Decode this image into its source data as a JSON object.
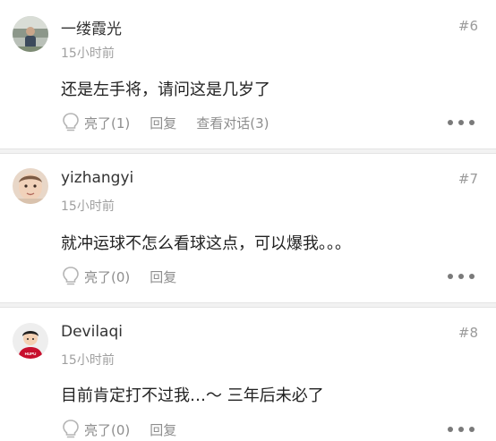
{
  "comments": [
    {
      "username": "一缕霞光",
      "floor": "#6",
      "time": "15小时前",
      "text": "还是左手将，请问这是几岁了",
      "like": "亮了(1)",
      "reply": "回复",
      "view_conversation": "查看对话(3)",
      "avatar_icon": "user-photo-avatar",
      "more_icon": "more-dots-icon"
    },
    {
      "username": "yizhangyi",
      "floor": "#7",
      "time": "15小时前",
      "text": "就冲运球不怎么看球这点，可以爆我。。。",
      "like": "亮了(0)",
      "reply": "回复",
      "avatar_icon": "child-photo-avatar",
      "more_icon": "more-dots-icon"
    },
    {
      "username": "Devilaqi",
      "floor": "#8",
      "time": "15小时前",
      "text": "目前肯定打不过我…～ 三年后未必了",
      "like": "亮了(0)",
      "reply": "回复",
      "avatar_icon": "cartoon-hupu-avatar",
      "avatar_badge": "HUPU",
      "more_icon": "more-dots-icon"
    }
  ],
  "colors": {
    "text_primary": "#222222",
    "text_secondary": "#9a9a9a",
    "separator": "#f2f2f2",
    "hupu_red": "#c8102e"
  }
}
